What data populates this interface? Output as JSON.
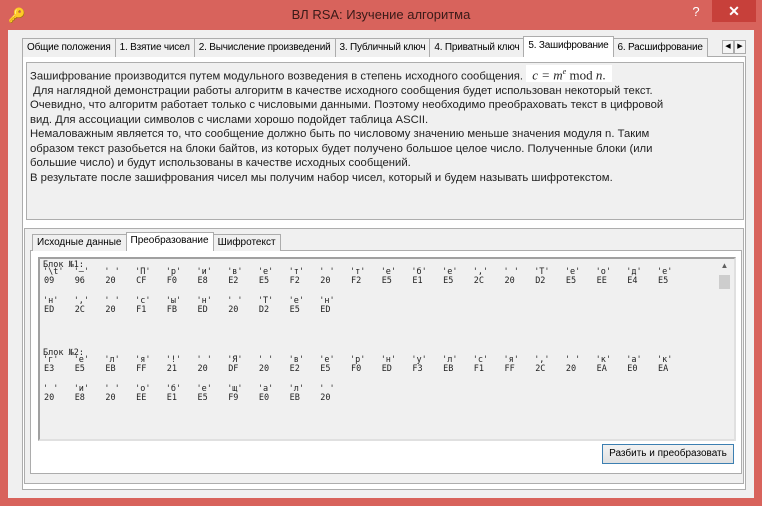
{
  "window": {
    "title": "ВЛ RSA: Изучение алгоритма",
    "help": "?",
    "close": "✕"
  },
  "tabs": [
    "Общие положения",
    "1. Взятие чисел",
    "2. Вычисление произведений",
    "3. Публичный ключ",
    "4. Приватный ключ",
    "5. Зашифрование",
    "6. Расшифрование"
  ],
  "active_tab": 5,
  "description": {
    "line1": "Зашифрование производится путем модульного возведения в степень исходного сообщения.",
    "formula_lhs": "c = m",
    "formula_sup": "e",
    "formula_mod": " mod ",
    "formula_n": "n",
    "formula_end": ".",
    "lines": [
      " Для наглядной демонстрации работы алгоритм в качестве исходного сообщения будет использован некоторый текст.",
      "Очевидно, что алгоритм работает только с числовыми данными. Поэтому необходимо преобраховать текст в цифровой",
      "вид. Для ассоциации символов с числами хорошо подойдет таблица ASCII.",
      "Немаловажным является то, что сообщение должно быть по числовому значению меньше значения модуля n. Таким",
      "образом текст разобьется на блоки байтов, из которых будет получено большое целое число. Полученные блоки (или",
      "большие число) и будут использованы в качестве исходных сообщений.",
      "В результате после зашифрования чисел мы получим набор чисел, который и будем называть шифротекстом."
    ]
  },
  "inner_tabs": [
    "Исходные данные",
    "Преобразование",
    "Шифротекст"
  ],
  "inner_active": 1,
  "blocks": [
    {
      "label": "Блок №1:",
      "rows": [
        [
          [
            "'\\t'",
            "09"
          ],
          [
            "'–'",
            "96"
          ],
          [
            "' '",
            "20"
          ],
          [
            "'П'",
            "CF"
          ],
          [
            "'р'",
            "F0"
          ],
          [
            "'и'",
            "E8"
          ],
          [
            "'в'",
            "E2"
          ],
          [
            "'е'",
            "E5"
          ],
          [
            "'т'",
            "F2"
          ],
          [
            "' '",
            "20"
          ],
          [
            "'т'",
            "F2"
          ],
          [
            "'е'",
            "E5"
          ],
          [
            "'б'",
            "E1"
          ],
          [
            "'е'",
            "E5"
          ],
          [
            "','",
            "2C"
          ],
          [
            "' '",
            "20"
          ],
          [
            "'Т'",
            "D2"
          ],
          [
            "'е'",
            "E5"
          ],
          [
            "'о'",
            "EE"
          ],
          [
            "'д'",
            "E4"
          ],
          [
            "'е'",
            "E5"
          ]
        ],
        [
          [
            "'н'",
            "ED"
          ],
          [
            "','",
            "2C"
          ],
          [
            "' '",
            "20"
          ],
          [
            "'с'",
            "F1"
          ],
          [
            "'ы'",
            "FB"
          ],
          [
            "'н'",
            "ED"
          ],
          [
            "' '",
            "20"
          ],
          [
            "'Т'",
            "D2"
          ],
          [
            "'е'",
            "E5"
          ],
          [
            "'н'",
            "ED"
          ]
        ]
      ]
    },
    {
      "label": "Блок №2:",
      "rows": [
        [
          [
            "'г'",
            "E3"
          ],
          [
            "'е'",
            "E5"
          ],
          [
            "'л'",
            "EB"
          ],
          [
            "'я'",
            "FF"
          ],
          [
            "'!'",
            "21"
          ],
          [
            "' '",
            "20"
          ],
          [
            "'Я'",
            "DF"
          ],
          [
            "' '",
            "20"
          ],
          [
            "'в'",
            "E2"
          ],
          [
            "'е'",
            "E5"
          ],
          [
            "'р'",
            "F0"
          ],
          [
            "'н'",
            "ED"
          ],
          [
            "'у'",
            "F3"
          ],
          [
            "'л'",
            "EB"
          ],
          [
            "'с'",
            "F1"
          ],
          [
            "'я'",
            "FF"
          ],
          [
            "','",
            "2C"
          ],
          [
            "' '",
            "20"
          ],
          [
            "'к'",
            "EA"
          ],
          [
            "'а'",
            "E0"
          ],
          [
            "'к'",
            "EA"
          ]
        ],
        [
          [
            "' '",
            "20"
          ],
          [
            "'и'",
            "E8"
          ],
          [
            "' '",
            "20"
          ],
          [
            "'о'",
            "EE"
          ],
          [
            "'б'",
            "E1"
          ],
          [
            "'е'",
            "E5"
          ],
          [
            "'щ'",
            "F9"
          ],
          [
            "'а'",
            "E0"
          ],
          [
            "'л'",
            "EB"
          ],
          [
            "' '",
            "20"
          ]
        ]
      ]
    }
  ],
  "button": "Разбить и преобразовать"
}
